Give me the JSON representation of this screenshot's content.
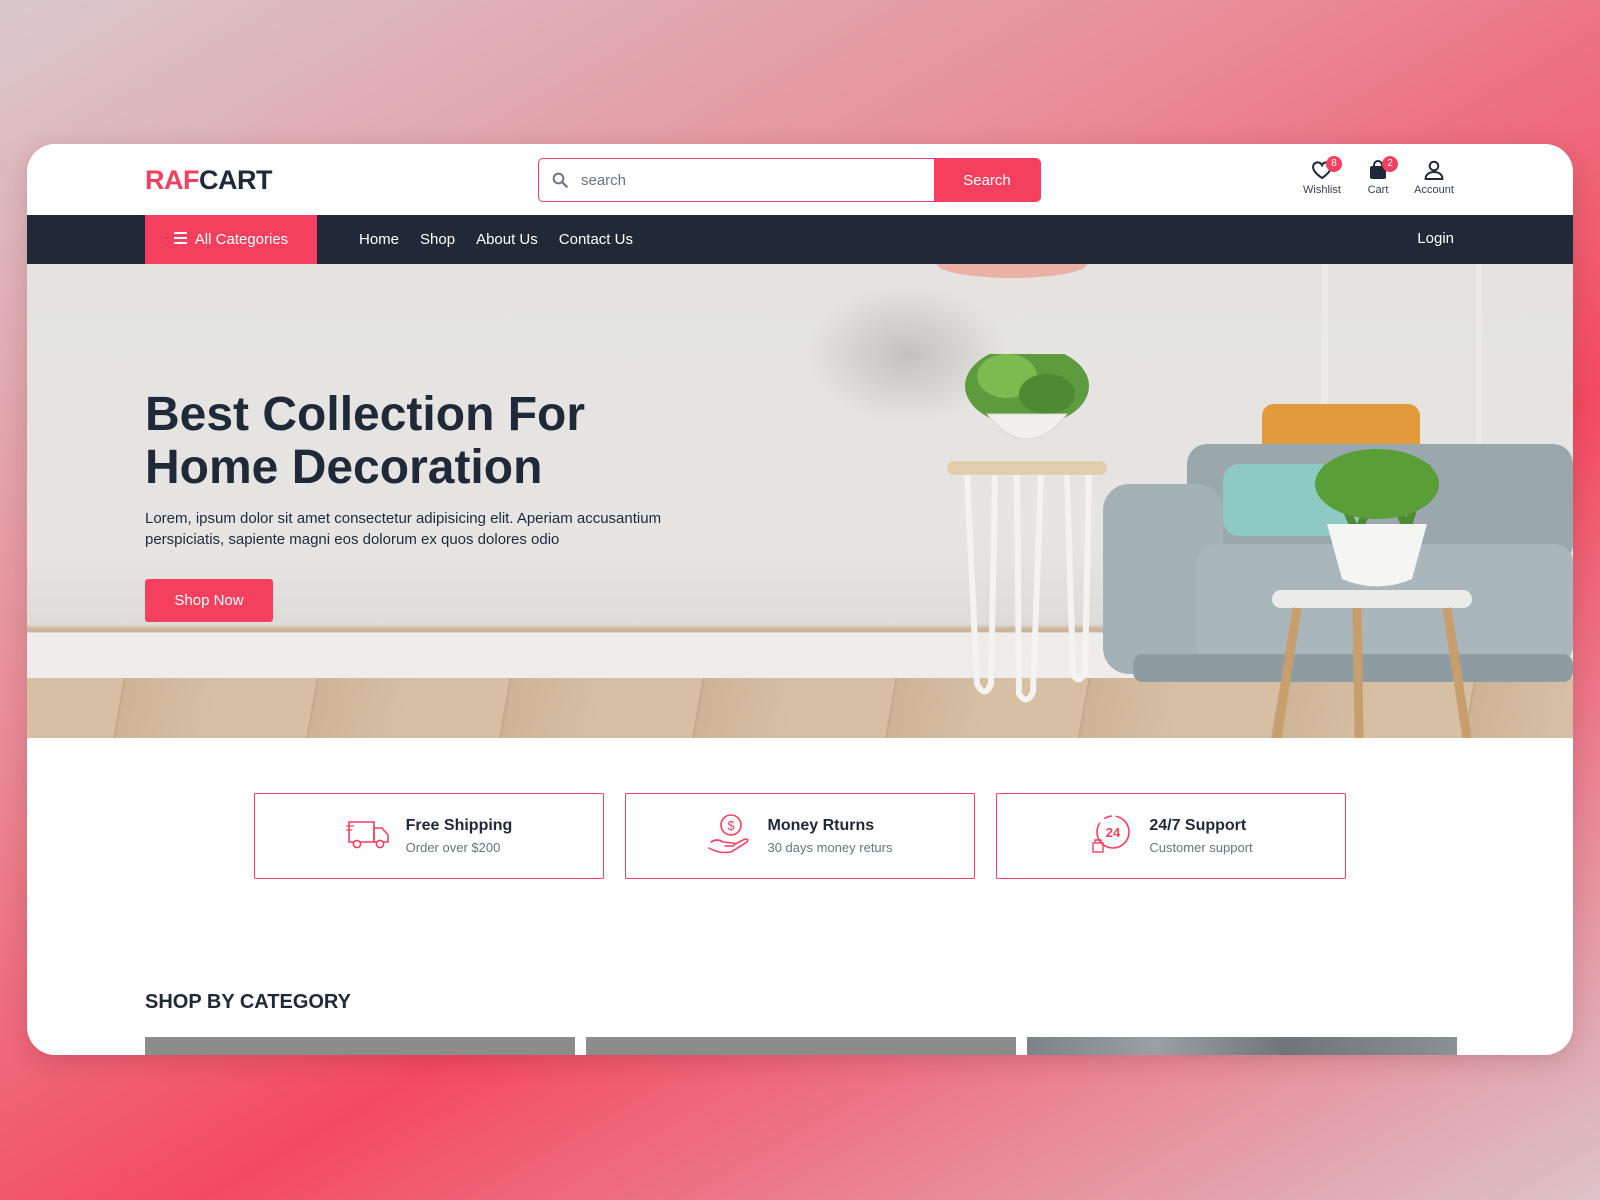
{
  "header": {
    "logo_part1": "RAF",
    "logo_part2": "CART",
    "search_placeholder": "search",
    "search_button": "Search",
    "wishlist_label": "Wishlist",
    "wishlist_count": "8",
    "cart_label": "Cart",
    "cart_count": "2",
    "account_label": "Account"
  },
  "nav": {
    "all_categories": "All Categories",
    "links": [
      "Home",
      "Shop",
      "About Us",
      "Contact Us"
    ],
    "login": "Login"
  },
  "hero": {
    "title_line1": "Best Collection For",
    "title_line2": "Home Decoration",
    "text": "Lorem, ipsum dolor sit amet consectetur adipisicing elit. Aperiam accusantium perspiciatis, sapiente magni eos dolorum ex quos dolores odio",
    "button": "Shop Now"
  },
  "features": [
    {
      "icon": "truck-icon",
      "title": "Free Shipping",
      "subtitle": "Order over $200"
    },
    {
      "icon": "money-hand-icon",
      "title": "Money Rturns",
      "subtitle": "30 days money returs"
    },
    {
      "icon": "support-24-icon",
      "title": "24/7 Support",
      "subtitle": "Customer support"
    }
  ],
  "category": {
    "title": "SHOP BY CATEGORY"
  },
  "colors": {
    "accent": "#f43f5e",
    "dark": "#1f2937"
  }
}
